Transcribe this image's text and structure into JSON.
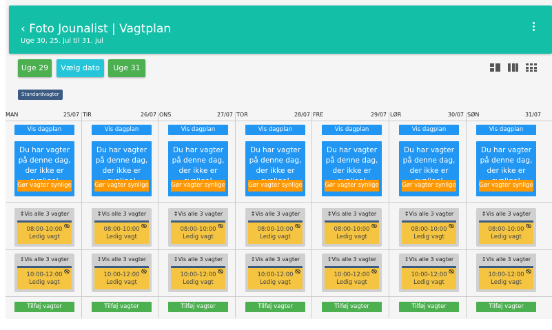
{
  "header": {
    "back_icon": "chevron-left-icon",
    "title": "Foto Jounalist | Vagtplan",
    "subtitle": "Uge 30, 25. jul til 31. jul",
    "menu_icon": "more-vert-icon"
  },
  "toolbar": {
    "prev_week": "Uge 29",
    "pick_date": "Vælg dato",
    "next_week": "Uge 31",
    "view_icons": [
      "view-compact-icon",
      "view-week-icon",
      "view-module-icon"
    ]
  },
  "tag": "Standardvagter",
  "labels": {
    "show_dayplan": "Vis dagplan",
    "notice": "Du har vagter på denne dag, der ikke er synlige!",
    "make_visible": "Gør vagter synlige",
    "show_all": "↕Vis alle 3 vagter",
    "free_shift": "Ledig vagt",
    "add_shifts": "Tilføj vagter"
  },
  "days": [
    {
      "day": "MAN",
      "date": "25/07"
    },
    {
      "day": "TIR",
      "date": "26/07"
    },
    {
      "day": "ONS",
      "date": "27/07"
    },
    {
      "day": "TOR",
      "date": "28/07"
    },
    {
      "day": "FRE",
      "date": "29/07"
    },
    {
      "day": "LØR",
      "date": "30/07"
    },
    {
      "day": "SØN",
      "date": "31/07"
    }
  ],
  "shift_groups": [
    {
      "time": "08:00-10:00"
    },
    {
      "time": "10:00-12:00"
    }
  ],
  "colors": {
    "header": "#14bfa8",
    "green": "#4caf50",
    "cyan": "#26c6da",
    "blue": "#2196f3",
    "orange": "#ff9800",
    "shift": "#f5c542",
    "tag": "#3b5b83"
  }
}
